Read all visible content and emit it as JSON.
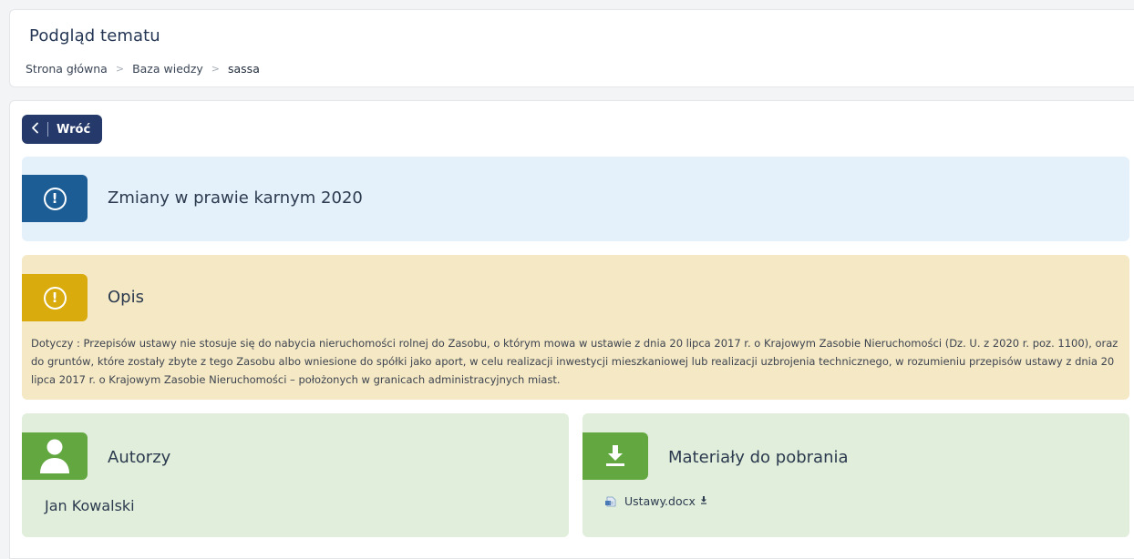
{
  "header": {
    "title": "Podgląd tematu",
    "breadcrumb": {
      "home": "Strona główna",
      "section": "Baza wiedzy",
      "current": "sassa",
      "separator": ">"
    }
  },
  "back_button": {
    "icon": "chevron-left-icon",
    "label": "Wróć"
  },
  "topic": {
    "title": "Zmiany w prawie karnym 2020",
    "icon": "exclamation-circle-icon",
    "color": "#1c5d95"
  },
  "description": {
    "title": "Opis",
    "icon": "exclamation-circle-icon",
    "color": "#d9ab0d",
    "text": "Dotyczy : Przepisów ustawy nie stosuje się do nabycia nieruchomości rolnej do Zasobu, o którym mowa w ustawie z dnia 20 lipca 2017 r. o Krajowym Zasobie Nieruchomości (Dz. U. z 2020 r. poz. 1100), oraz do gruntów, które zostały zbyte z tego Zasobu albo wniesione do spółki jako aport, w celu realizacji inwestycji mieszkaniowej lub realizacji uzbrojenia technicznego, w rozumieniu przepisów ustawy z dnia 20 lipca 2017 r. o Krajowym Zasobie Nieruchomości – położonych w granicach administracyjnych miast."
  },
  "authors": {
    "title": "Autorzy",
    "icon": "user-icon",
    "color": "#63a740",
    "items": [
      "Jan Kowalski"
    ]
  },
  "materials": {
    "title": "Materiały do pobrania",
    "icon": "download-icon",
    "color": "#63a740",
    "files": [
      {
        "name": "Ustawy.docx",
        "icon": "document-icon",
        "action_icon": "download-icon"
      }
    ]
  }
}
